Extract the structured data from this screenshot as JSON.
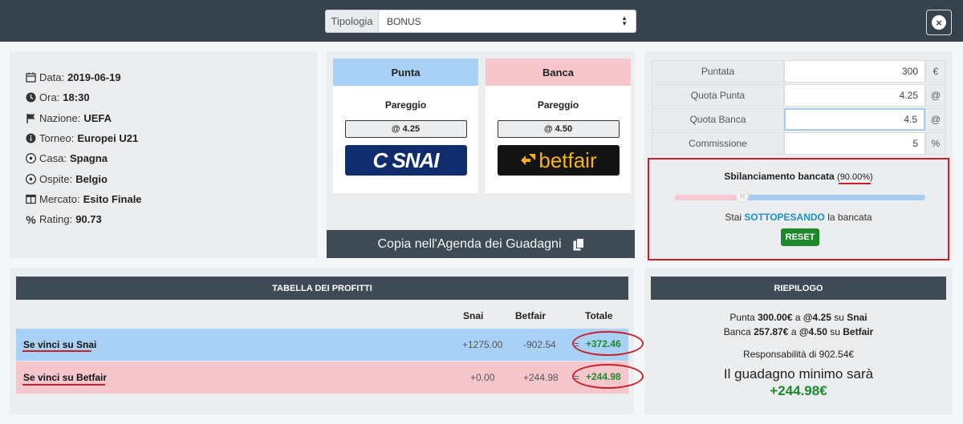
{
  "header": {
    "tipologia_label": "Tipologia",
    "tipologia_value": "BONUS",
    "close_label": "×"
  },
  "info": {
    "data_label": "Data:",
    "data_value": "2019-06-19",
    "ora_label": "Ora:",
    "ora_value": "18:30",
    "nazione_label": "Nazione:",
    "nazione_value": "UEFA",
    "torneo_label": "Torneo:",
    "torneo_value": "Europei U21",
    "casa_label": "Casa:",
    "casa_value": "Spagna",
    "ospite_label": "Ospite:",
    "ospite_value": "Belgio",
    "mercato_label": "Mercato:",
    "mercato_value": "Esito Finale",
    "rating_label": "Rating:",
    "rating_value": "90.73"
  },
  "books": {
    "punta": {
      "title": "Punta",
      "selection": "Pareggio",
      "odds": "@ 4.25",
      "logo": "C SNAI"
    },
    "banca": {
      "title": "Banca",
      "selection": "Pareggio",
      "odds": "@ 4.50",
      "logo": "betfair"
    },
    "copy_label": "Copia nell'Agenda dei Guadagni"
  },
  "calc": {
    "puntata": {
      "label": "Puntata",
      "value": "300",
      "unit": "€"
    },
    "quota_punta": {
      "label": "Quota Punta",
      "value": "4.25",
      "unit": "@"
    },
    "quota_banca": {
      "label": "Quota Banca",
      "value": "4.5",
      "unit": "@"
    },
    "commissione": {
      "label": "Commissione",
      "value": "5",
      "unit": "%"
    },
    "balance": {
      "title": "Sbilanciamento bancata",
      "percent": "(90.00%)",
      "slider_fraction": 0.27,
      "handle_label": "R",
      "msg_pre": "Stai",
      "msg_bold": "SOTTOPESANDO",
      "msg_post": "la bancata",
      "reset_label": "RESET"
    }
  },
  "profits": {
    "title": "TABELLA DEI PROFITTI",
    "col_snai": "Snai",
    "col_betfair": "Betfair",
    "col_totale": "Totale",
    "rows": [
      {
        "label_pre": "Se vinci su ",
        "label_book": "Snai",
        "snai": "+1275.00",
        "betfair": "-902.54",
        "eq": "=",
        "total": "+372.46"
      },
      {
        "label_pre": "Se vinci su ",
        "label_book": "Betfair",
        "snai": "+0.00",
        "betfair": "+244.98",
        "eq": "=",
        "total": "+244.98"
      }
    ]
  },
  "summary": {
    "title": "RIEPILOGO",
    "line1_pre": "Punta ",
    "line1_amount": "300.00€",
    "line1_mid": " a ",
    "line1_odds": "@4.25",
    "line1_su": " su ",
    "line1_book": "Snai",
    "line2_pre": "Banca ",
    "line2_amount": "257.87€",
    "line2_mid": " a ",
    "line2_odds": "@4.50",
    "line2_su": " su ",
    "line2_book": "Betfair",
    "responsabilita": "Responsabilità di 902.54€",
    "guadagno_label": "Il guadagno minimo sarà",
    "guadagno_value": "+244.98€"
  },
  "colors": {
    "punta_head": "#a8d1f5",
    "banca_head": "#f6c6cd",
    "accent_green": "#1c8a2b",
    "highlight_red": "#c8202a",
    "dark_bar": "#3e4b56"
  }
}
